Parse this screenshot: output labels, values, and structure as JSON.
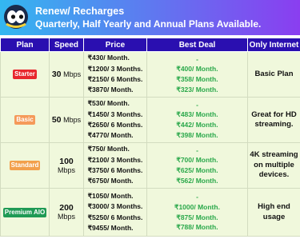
{
  "banner": {
    "logo_icon": "eyes-icon",
    "title": "Renew/ Recharges",
    "subtitle": "Quarterly, Half Yearly and Annual Plans Available."
  },
  "table": {
    "headers": [
      "Plan",
      "Speed",
      "Price",
      "Best Deal",
      "Only Internet"
    ],
    "rows": [
      {
        "plan": "Starter",
        "plan_color": "#e8272d",
        "speed_value": "30",
        "speed_unit": "Mbps",
        "prices": [
          "₹430/ Month.",
          "₹1200/ 3 Months.",
          "₹2150/ 6 Months.",
          "₹3870/ Month."
        ],
        "deals": [
          "-",
          "₹400/ Month.",
          "₹358/ Month.",
          "₹323/ Month."
        ],
        "internet": "Basic Plan"
      },
      {
        "plan": "Basic",
        "plan_color": "#f59a5a",
        "speed_value": "50",
        "speed_unit": "Mbps",
        "prices": [
          "₹530/ Month.",
          "₹1450/ 3 Months.",
          "₹2650/ 6 Months.",
          "₹4770/ Month."
        ],
        "deals": [
          "-",
          "₹483/ Month.",
          "₹442/ Month.",
          "₹398/ Month."
        ],
        "internet": "Great for HD streaming."
      },
      {
        "plan": "Standard",
        "plan_color": "#f2a04c",
        "speed_value": "100",
        "speed_unit": "Mbps",
        "prices": [
          "₹750/ Month.",
          "₹2100/ 3 Months.",
          "₹3750/ 6 Months.",
          "₹6750/ Month."
        ],
        "deals": [
          "-",
          "₹700/ Month.",
          "₹625/ Month.",
          "₹562/ Month."
        ],
        "internet": "4K streaming on multiple devices."
      },
      {
        "plan": "Premium AIO",
        "plan_color": "#1f9a55",
        "speed_value": "200",
        "speed_unit": "Mbps",
        "prices": [
          "₹1050/ Month.",
          "₹3000/ 3 Months.",
          "₹5250/ 6 Months.",
          "₹9455/ Month."
        ],
        "deals": [
          "-",
          "₹1000/ Month.",
          "₹875/ Month.",
          "₹788/ Month."
        ],
        "internet": "High end usage"
      }
    ]
  },
  "colors": {
    "header_bg": "#2a0fb0",
    "row_bg": "#f0f8dc",
    "deal_text": "#2aa84a"
  }
}
